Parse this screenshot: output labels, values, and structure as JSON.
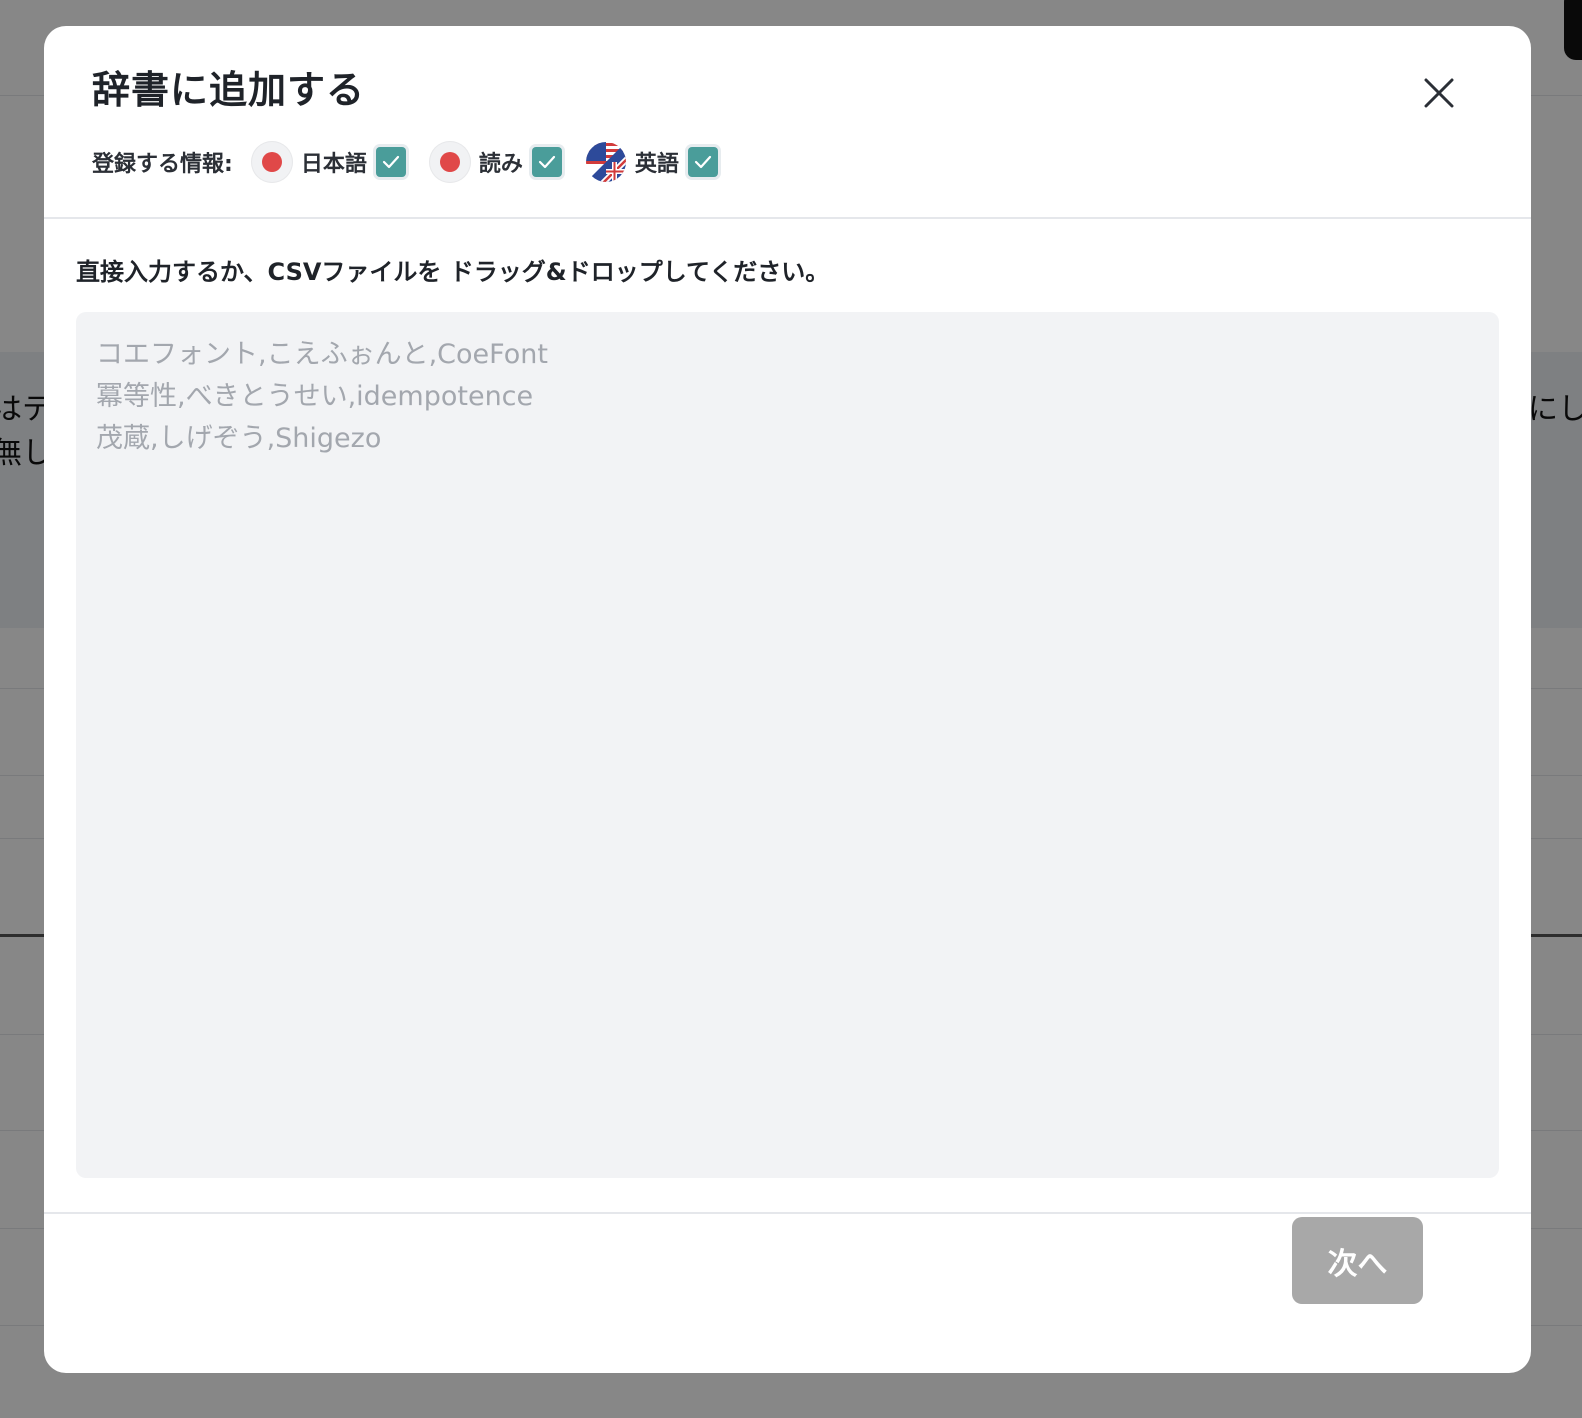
{
  "background": {
    "left_text": [
      "はテ",
      "無し"
    ],
    "right_text": [
      "にしま"
    ]
  },
  "modal": {
    "title": "辞書に追加する",
    "close_label": "×",
    "info_label": "登録する情報:",
    "fields": [
      {
        "label": "日本語",
        "flag": "jp-flag-icon",
        "checked": true
      },
      {
        "label": "読み",
        "flag": "jp-flag-icon",
        "checked": true
      },
      {
        "label": "英語",
        "flag": "us-uk-flag-icon",
        "checked": true
      }
    ],
    "instruction": "直接入力するか、CSVファイルを ドラッグ&ドロップしてください。",
    "textarea": {
      "value": "",
      "placeholder": "コエフォント,こえふぉんと,CoeFont\n冪等性,べきとうせい,idempotence\n茂蔵,しげぞう,Shigezo"
    },
    "next_label": "次へ"
  },
  "colors": {
    "check_accent": "#4a9d9a",
    "jp_red": "#e04848",
    "next_disabled": "#a8a8a8",
    "textarea_bg": "#f2f3f5"
  }
}
